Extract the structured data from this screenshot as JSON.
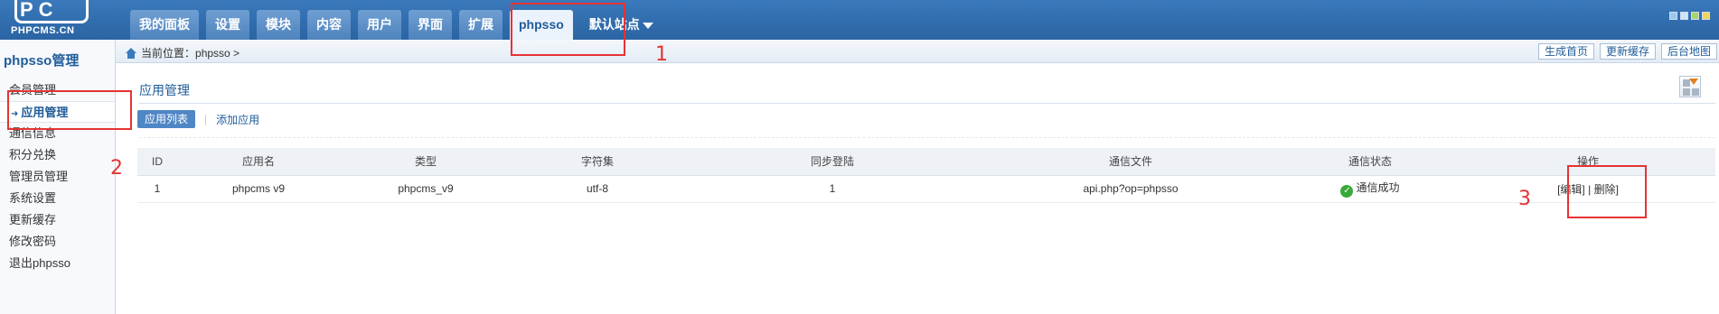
{
  "header": {
    "logo_text": "PHPCMS.CN",
    "logo_letters": "PC",
    "nav": [
      {
        "label": "我的面板",
        "active": false
      },
      {
        "label": "设置",
        "active": false
      },
      {
        "label": "模块",
        "active": false
      },
      {
        "label": "内容",
        "active": false
      },
      {
        "label": "用户",
        "active": false
      },
      {
        "label": "界面",
        "active": false
      },
      {
        "label": "扩展",
        "active": false
      },
      {
        "label": "phpsso",
        "active": true
      },
      {
        "label": "默认站点",
        "active": false
      }
    ]
  },
  "sidebar": {
    "title": "phpsso管理",
    "items": [
      {
        "label": "会员管理"
      },
      {
        "label": "应用管理",
        "active": true
      },
      {
        "label": "通信信息"
      },
      {
        "label": "积分兑换"
      },
      {
        "label": "管理员管理"
      },
      {
        "label": "系统设置"
      },
      {
        "label": "更新缓存"
      },
      {
        "label": "修改密码"
      },
      {
        "label": "退出phpsso"
      }
    ]
  },
  "breadcrumb": {
    "prefix": "当前位置：",
    "path": "phpsso >",
    "buttons": [
      "生成首页",
      "更新缓存",
      "后台地图"
    ]
  },
  "content": {
    "title": "应用管理",
    "subnav": {
      "active": "应用列表",
      "link": "添加应用",
      "separator": "|"
    },
    "table": {
      "headers": [
        "ID",
        "应用名",
        "类型",
        "字符集",
        "同步登陆",
        "通信文件",
        "通信状态",
        "操作"
      ],
      "rows": [
        {
          "id": "1",
          "name": "phpcms v9",
          "type": "phpcms_v9",
          "charset": "utf-8",
          "sync": "1",
          "file": "api.php?op=phpsso",
          "status": "通信成功",
          "edit": "[编辑]",
          "sep": "|",
          "delete": "删除]"
        }
      ]
    }
  },
  "annotations": [
    "1",
    "2",
    "3"
  ],
  "colors": {
    "header_blue": "#2e6db0",
    "link_blue": "#1f5c99",
    "annotation_red": "#e53333",
    "success_green": "#3aa93a"
  }
}
